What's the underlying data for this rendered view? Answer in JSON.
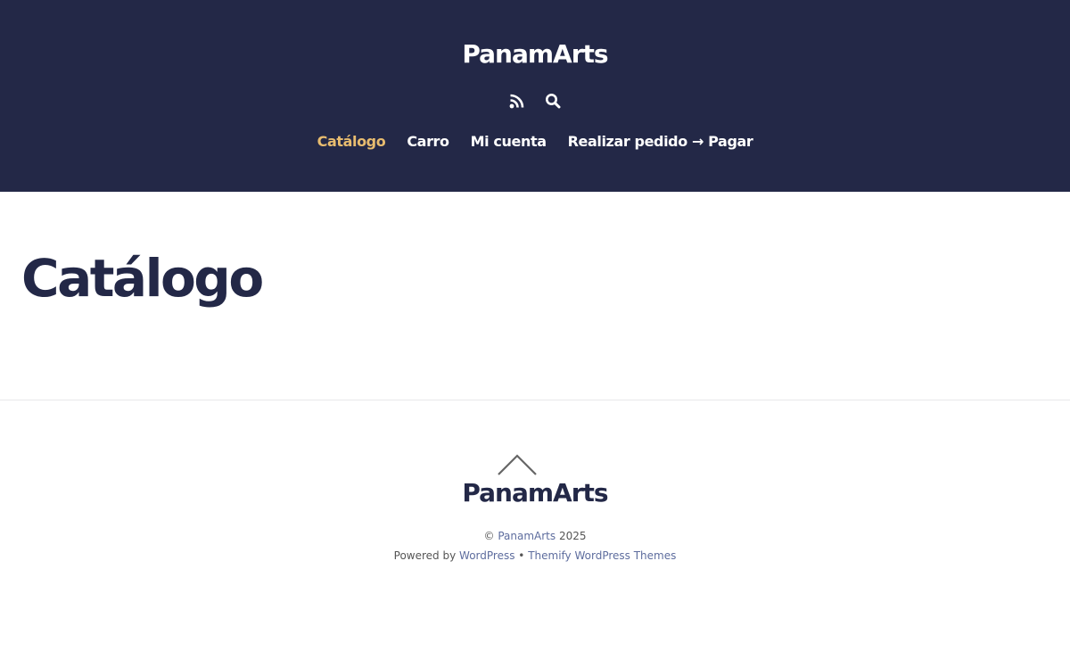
{
  "header": {
    "site_title": "PanamArts",
    "nav": [
      {
        "label": "Catálogo",
        "active": true
      },
      {
        "label": "Carro",
        "active": false
      },
      {
        "label": "Mi cuenta",
        "active": false
      },
      {
        "label": "Realizar pedido → Pagar",
        "active": false
      }
    ],
    "icons": [
      "rss-icon",
      "search-icon"
    ]
  },
  "main": {
    "page_title": "Catálogo"
  },
  "footer": {
    "back_to_top_icon": "chevron-up-icon",
    "site_title": "PanamArts",
    "copyright_symbol": "©",
    "copyright_link": "PanamArts",
    "year": "2025",
    "powered_by": "Powered by",
    "wordpress_link": "WordPress",
    "separator": "•",
    "themify_link": "Themify WordPress Themes"
  },
  "colors": {
    "header_bg": "#232847",
    "nav_active": "#e8bc6f",
    "title_text": "#232847",
    "link": "#5e6d9e"
  }
}
